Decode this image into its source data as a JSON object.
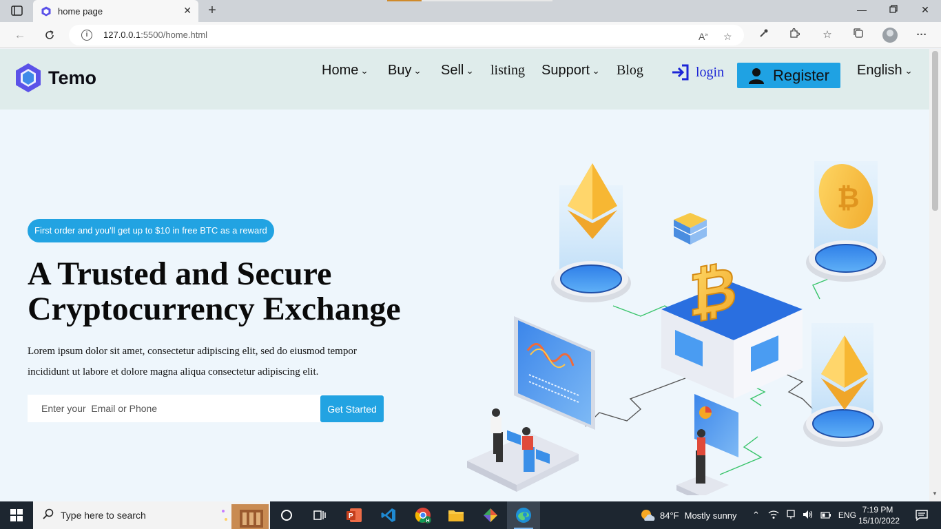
{
  "browser": {
    "tab_title": "home page",
    "url_host": "127.0.0.1",
    "url_rest": ":5500/home.html"
  },
  "site": {
    "brand": "Temo",
    "nav": {
      "home": "Home",
      "buy": "Buy",
      "sell": "Sell",
      "listing": "listing",
      "support": "Support",
      "blog": "Blog"
    },
    "login": "login",
    "register": "Register",
    "language": "English"
  },
  "hero": {
    "badge": "First order and you'll get up to $10 in free BTC as a reward",
    "headline_line1": "A Trusted and Secure",
    "headline_line2": "Cryptocurrency Exchange",
    "lead_line1": "Lorem ipsum dolor sit amet, consectetur adipiscing elit, sed do eiusmod tempor",
    "lead_line2": "incididunt ut labore et dolore magna aliqua consectetur adipiscing elit.",
    "input_placeholder": "Enter your  Email or Phone",
    "cta": "Get Started"
  },
  "taskbar": {
    "search_placeholder": "Type here to search",
    "weather_temp": "84°F",
    "weather_text": "Mostly sunny",
    "lang": "ENG",
    "time": "7:19 PM",
    "date": "15/10/2022"
  },
  "colors": {
    "accent": "#22a3e2",
    "header_bg": "#dfeceb",
    "page_bg": "#eef6fc",
    "login_blue": "#1c25d6",
    "logo_purple": "#5b52e8"
  }
}
